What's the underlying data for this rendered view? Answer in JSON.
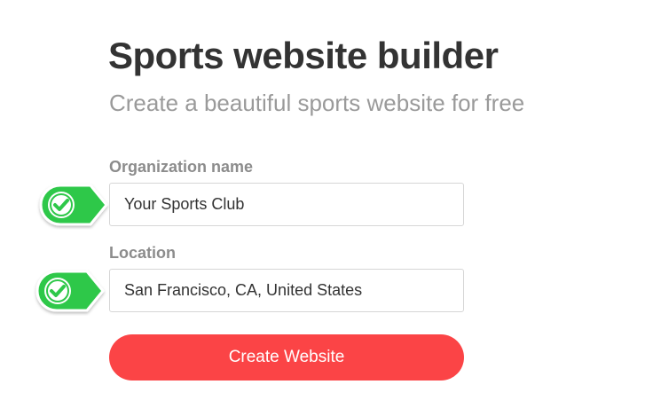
{
  "header": {
    "title": "Sports website builder",
    "subtitle": "Create a beautiful sports website for free"
  },
  "form": {
    "organization": {
      "label": "Organization name",
      "value": "Your Sports Club",
      "status_icon": "checkmark-icon"
    },
    "location": {
      "label": "Location",
      "value": "San Francisco, CA, United States",
      "status_icon": "checkmark-icon"
    },
    "submit_label": "Create Website"
  },
  "colors": {
    "accent": "#fb4446",
    "check_green": "#2ec84a",
    "title": "#333333",
    "subtitle": "#9a9a9a",
    "label": "#8c8c8c"
  }
}
